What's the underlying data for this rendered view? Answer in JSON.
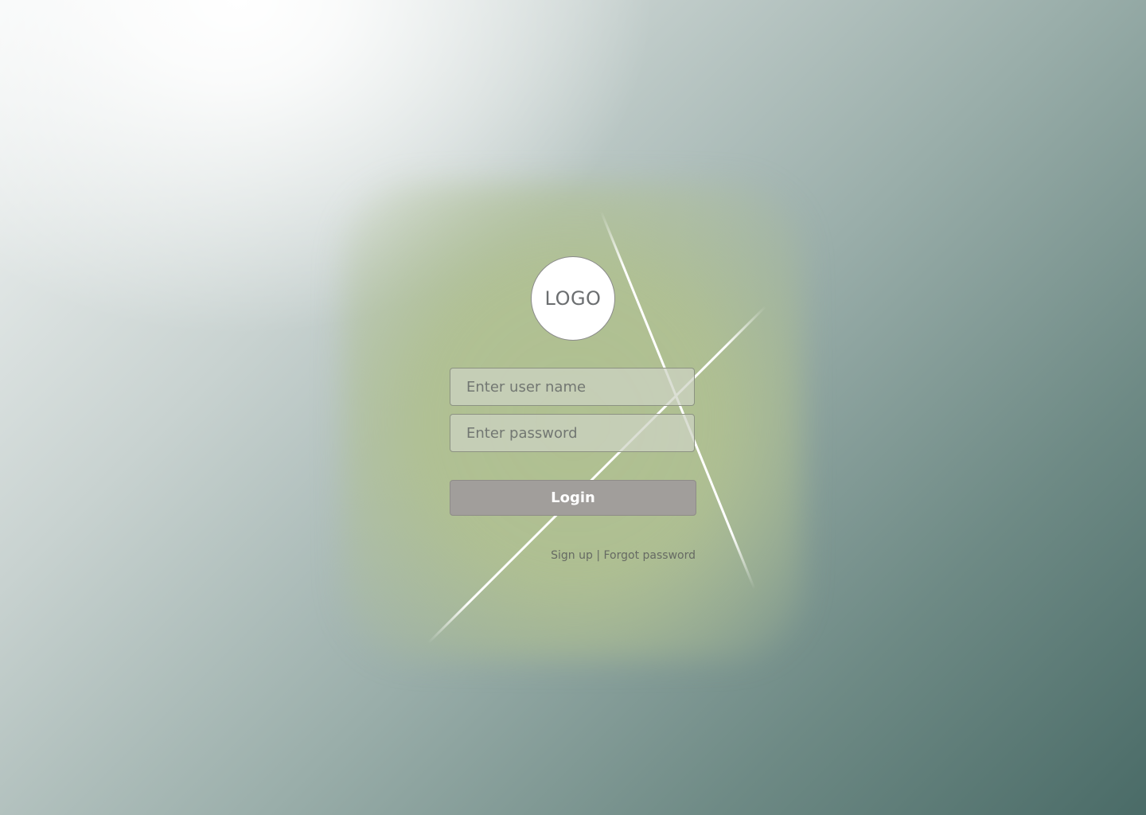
{
  "logo": {
    "text": "LOGO"
  },
  "form": {
    "username_placeholder": "Enter user name",
    "password_placeholder": "Enter password",
    "login_label": "Login"
  },
  "links": {
    "signup": "Sign up",
    "separator": " | ",
    "forgot": "Forgot password"
  },
  "colors": {
    "background_light": "#f4f6f6",
    "background_dark": "#4a6b67",
    "glow": "#b0c091",
    "button": "#a19e9b"
  }
}
